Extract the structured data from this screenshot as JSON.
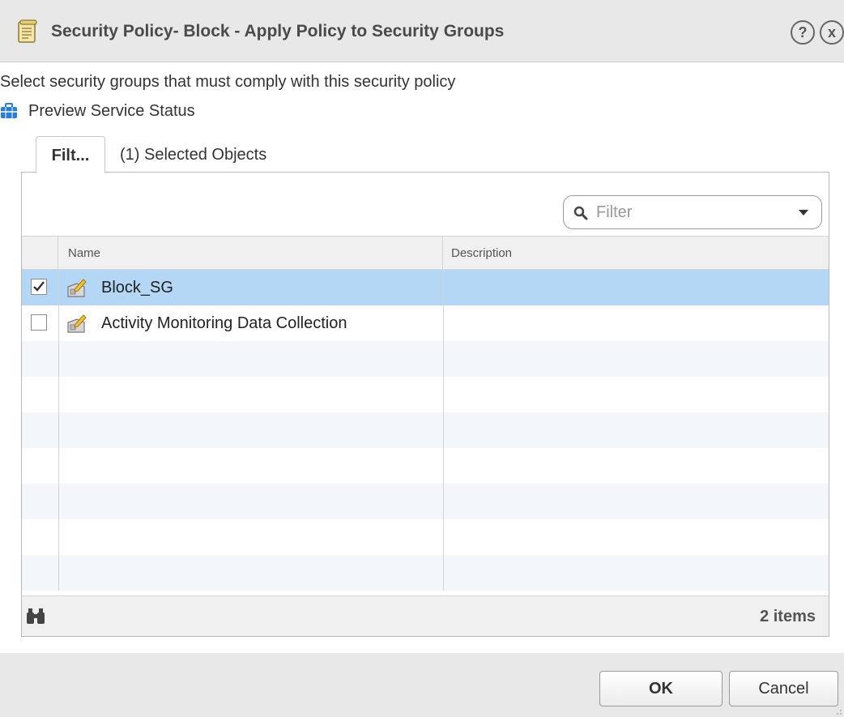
{
  "dialog": {
    "title": "Security Policy- Block - Apply Policy to Security Groups",
    "help_label": "?",
    "close_label": "x"
  },
  "instruction": "Select security groups that must comply with this security policy",
  "preview_link": "Preview Service Status",
  "tabs": [
    {
      "label": "Filt...",
      "active": true
    },
    {
      "label": "(1) Selected Objects",
      "active": false
    }
  ],
  "filter": {
    "placeholder": "Filter",
    "value": ""
  },
  "grid": {
    "columns": [
      "Name",
      "Description"
    ],
    "rows": [
      {
        "name": "Block_SG",
        "description": "",
        "checked": true,
        "selected": true
      },
      {
        "name": "Activity Monitoring Data Collection",
        "description": "",
        "checked": false,
        "selected": false
      }
    ],
    "item_count": "2 items"
  },
  "buttons": {
    "ok": "OK",
    "cancel": "Cancel"
  },
  "colors": {
    "selected_row": "#b3d7f5",
    "alt_row": "#f3f6fa",
    "preview_icon": "#2a7fd4"
  }
}
